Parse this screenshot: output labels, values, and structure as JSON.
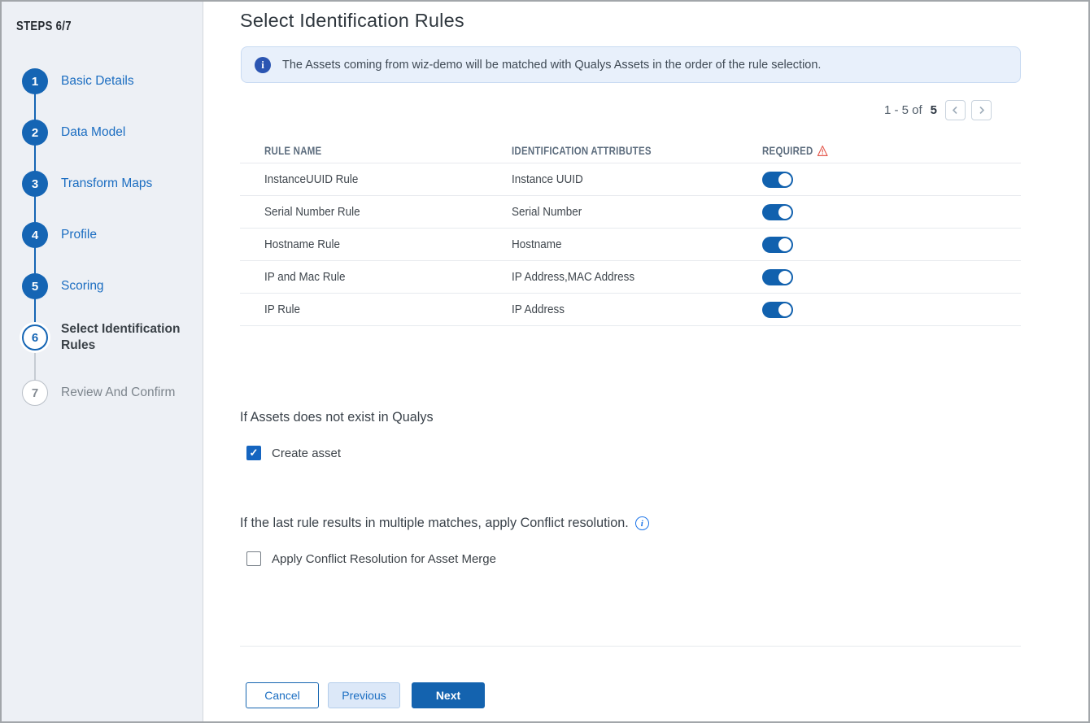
{
  "colors": {
    "primary_blue": "#1565b4",
    "link_blue": "#1b6dc1",
    "toggle_on": "#1161ae",
    "banner_bg": "#e8f0fb",
    "sidebar_bg": "#edf0f5",
    "warning_red": "#e4584c",
    "info_blue": "#1a73e8"
  },
  "icons": {
    "info": "i",
    "check": "✓",
    "chevron_left": "chevron-left",
    "chevron_right": "chevron-right",
    "warning_triangle": "warning-triangle"
  },
  "sidebar": {
    "header": "STEPS 6/7",
    "steps": [
      {
        "number": "1",
        "label": "Basic Details",
        "state": "completed"
      },
      {
        "number": "2",
        "label": "Data Model",
        "state": "completed"
      },
      {
        "number": "3",
        "label": "Transform Maps",
        "state": "completed"
      },
      {
        "number": "4",
        "label": "Profile",
        "state": "completed"
      },
      {
        "number": "5",
        "label": "Scoring",
        "state": "completed"
      },
      {
        "number": "6",
        "label": "Select Identification Rules",
        "state": "current"
      },
      {
        "number": "7",
        "label": "Review And Confirm",
        "state": "upcoming"
      }
    ]
  },
  "header": {
    "title": "Select Identification Rules"
  },
  "banner": {
    "text": "The Assets coming from wiz-demo will be matched with Qualys Assets in the order of the rule selection."
  },
  "pagination": {
    "range_text": "1 - 5 of",
    "total": "5"
  },
  "table": {
    "columns": {
      "rule_name": "RULE NAME",
      "attributes": "IDENTIFICATION ATTRIBUTES",
      "required": "REQUIRED"
    },
    "rows": [
      {
        "rule_name": "InstanceUUID Rule",
        "attributes": "Instance UUID",
        "required": true
      },
      {
        "rule_name": "Serial Number Rule",
        "attributes": "Serial Number",
        "required": true
      },
      {
        "rule_name": "Hostname Rule",
        "attributes": "Hostname",
        "required": true
      },
      {
        "rule_name": "IP and Mac Rule",
        "attributes": "IP Address,MAC Address",
        "required": true
      },
      {
        "rule_name": "IP Rule",
        "attributes": "IP Address",
        "required": true
      }
    ]
  },
  "sections": {
    "asset_missing": {
      "heading": "If Assets does not exist in Qualys",
      "checkbox_label": "Create asset",
      "checked": true
    },
    "conflict": {
      "heading": "If the last rule results in multiple matches, apply Conflict resolution.",
      "checkbox_label": "Apply Conflict Resolution for Asset Merge",
      "checked": false
    }
  },
  "footer": {
    "cancel_label": "Cancel",
    "previous_label": "Previous",
    "next_label": "Next"
  }
}
